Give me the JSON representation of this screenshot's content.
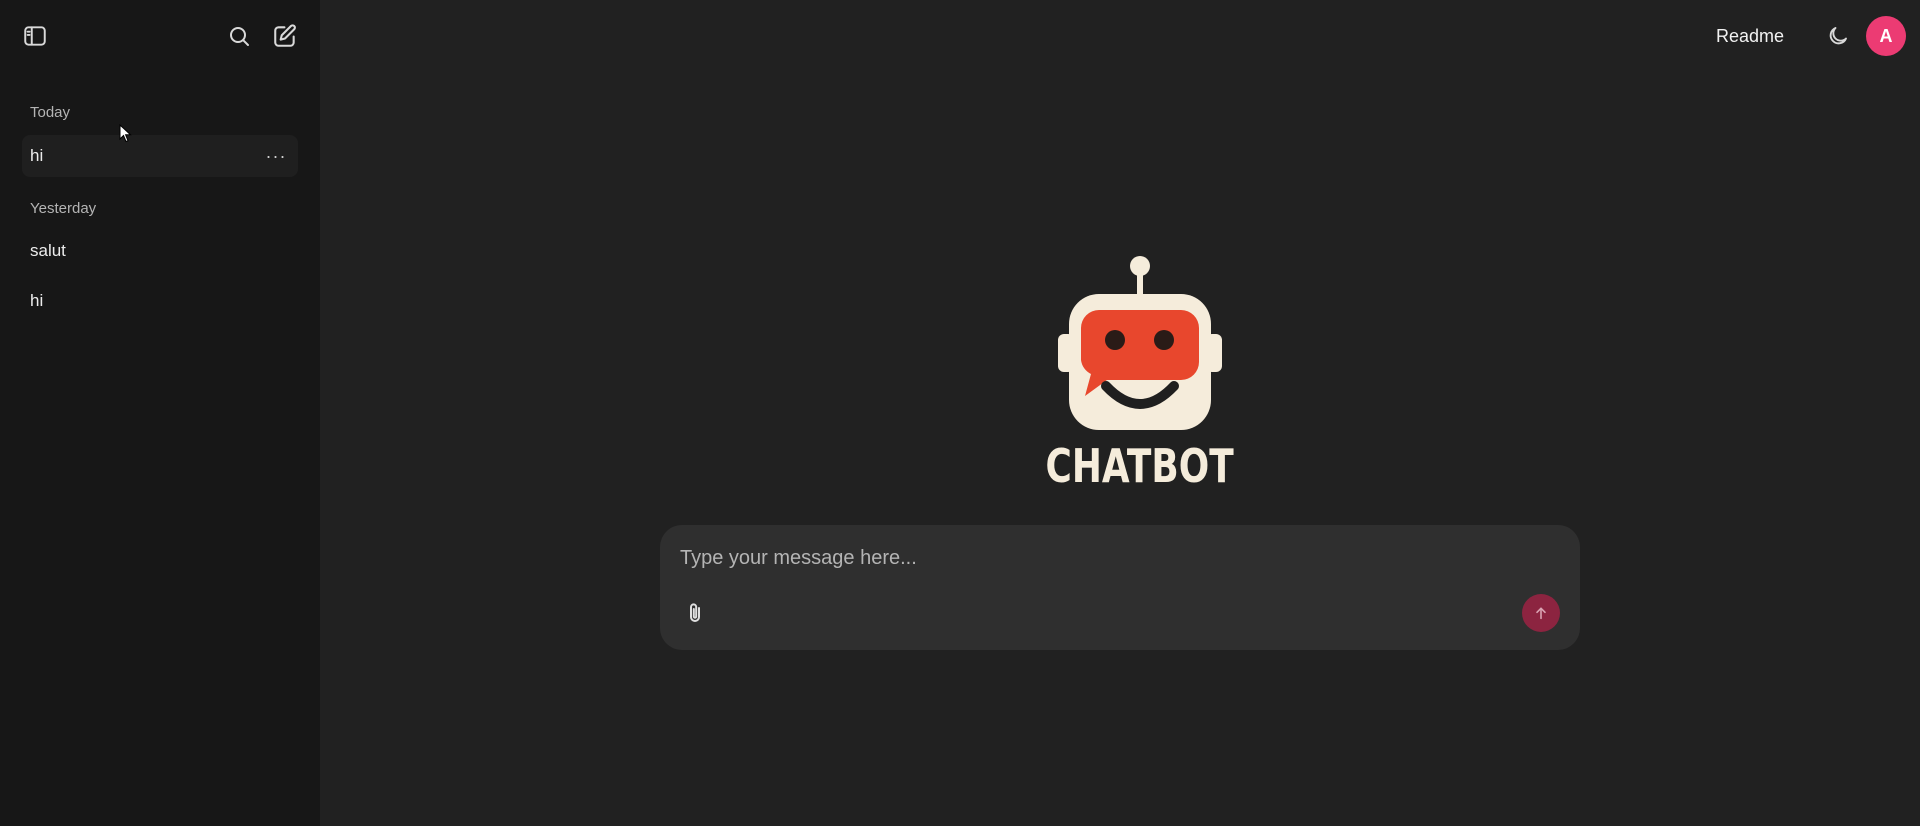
{
  "sidebar": {
    "toggle_icon": "sidebar-panel-icon",
    "search_icon": "search-icon",
    "new_chat_icon": "new-chat-icon",
    "groups": [
      {
        "label": "Today",
        "items": [
          {
            "label": "hi",
            "more": "···"
          }
        ]
      },
      {
        "label": "Yesterday",
        "items": [
          {
            "label": "salut"
          },
          {
            "label": "hi"
          }
        ]
      }
    ]
  },
  "header": {
    "readme_label": "Readme",
    "theme_icon": "moon-icon",
    "avatar_initial": "A"
  },
  "hero": {
    "logo_text": "CHATBOT",
    "logo_icon": "robot-logo-icon"
  },
  "composer": {
    "placeholder": "Type your message here...",
    "value": "",
    "attach_icon": "paperclip-icon",
    "send_icon": "arrow-up-icon"
  },
  "colors": {
    "background": "#212121",
    "sidebar": "#171717",
    "composer": "#2f2f2f",
    "avatar": "#ec3b73",
    "send_button": "#8c2440",
    "logo_red": "#e8472d",
    "logo_cream": "#f5ecdb"
  }
}
